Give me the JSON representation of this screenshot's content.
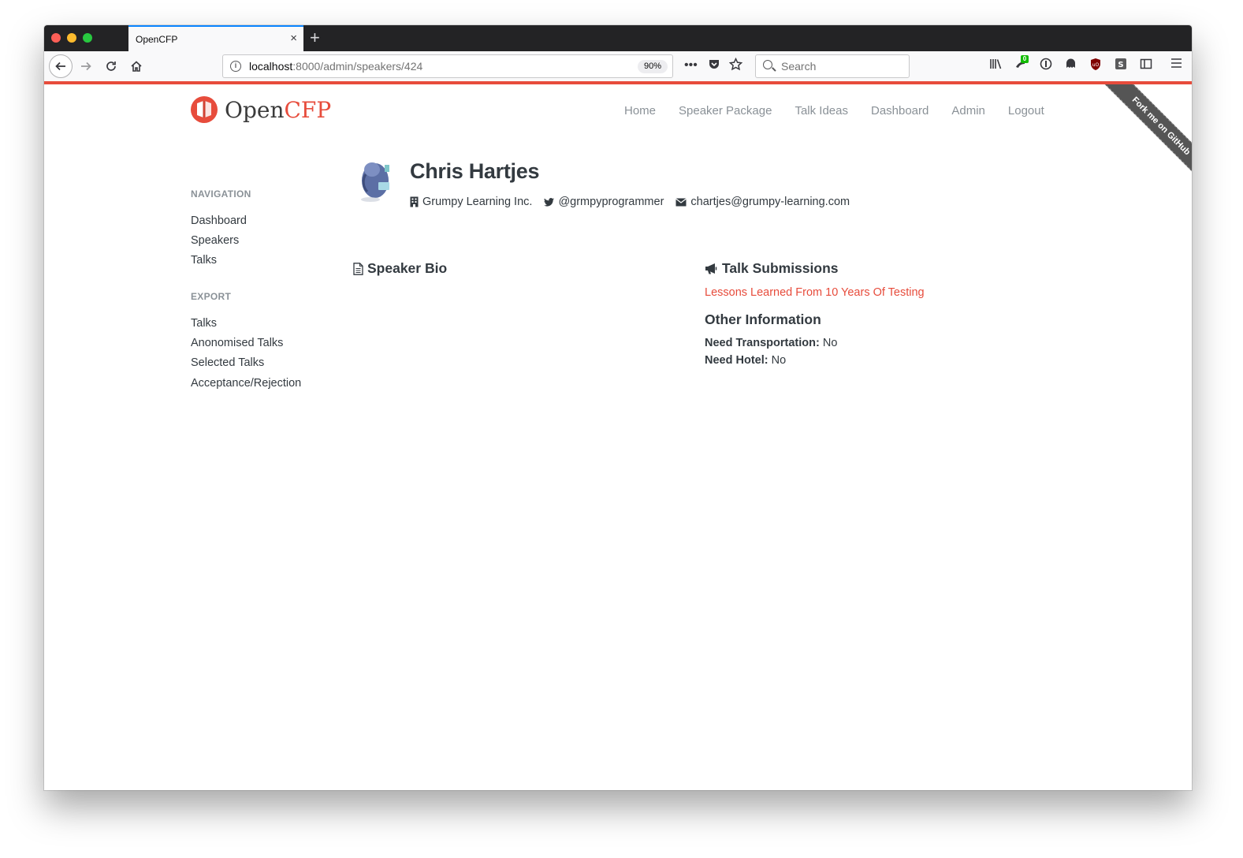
{
  "browser": {
    "tab_title": "OpenCFP",
    "url_host": "localhost",
    "url_path": ":8000/admin/speakers/424",
    "zoom": "90%",
    "search_placeholder": "Search",
    "extension_badge": "0",
    "new_tab_label": "+",
    "close_tab_label": "×"
  },
  "logo": {
    "part1": "Open",
    "part2": "CFP"
  },
  "topnav": [
    "Home",
    "Speaker Package",
    "Talk Ideas",
    "Dashboard",
    "Admin",
    "Logout"
  ],
  "ribbon": "Fork me on GitHub",
  "sidebar": {
    "navigation_heading": "NAVIGATION",
    "navigation": [
      "Dashboard",
      "Speakers",
      "Talks"
    ],
    "export_heading": "EXPORT",
    "export": [
      "Talks",
      "Anonomised Talks",
      "Selected Talks",
      "Acceptance/Rejection"
    ]
  },
  "speaker": {
    "name": "Chris Hartjes",
    "company": "Grumpy Learning Inc.",
    "twitter": "@grmpyprogrammer",
    "email": "chartjes@grumpy-learning.com"
  },
  "bio": {
    "title": "Speaker Bio"
  },
  "submissions": {
    "title": "Talk Submissions",
    "talks": [
      "Lessons Learned From 10 Years Of Testing"
    ]
  },
  "other": {
    "title": "Other Information",
    "transport_label": "Need Transportation:",
    "transport_value": "No",
    "hotel_label": "Need Hotel:",
    "hotel_value": "No"
  },
  "colors": {
    "accent": "#e74c3c",
    "text": "#333a40",
    "muted": "#8a9197"
  }
}
